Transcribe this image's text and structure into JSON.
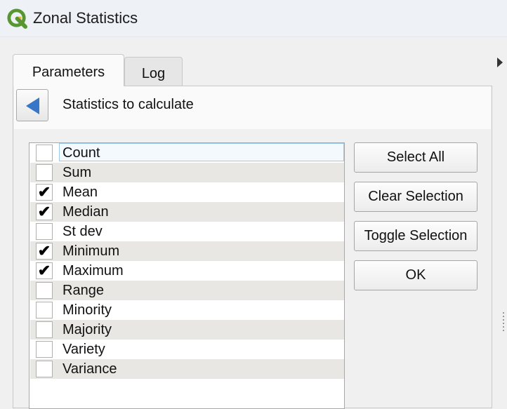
{
  "window": {
    "title": "Zonal Statistics",
    "icon": "qgis-logo-icon"
  },
  "tabs": [
    {
      "label": "Parameters",
      "active": true
    },
    {
      "label": "Log",
      "active": false
    }
  ],
  "panel": {
    "title": "Statistics to calculate",
    "back_icon": "back-arrow-icon"
  },
  "statistics": [
    {
      "label": "Count",
      "checked": false
    },
    {
      "label": "Sum",
      "checked": false
    },
    {
      "label": "Mean",
      "checked": true
    },
    {
      "label": "Median",
      "checked": true
    },
    {
      "label": "St dev",
      "checked": false
    },
    {
      "label": "Minimum",
      "checked": true
    },
    {
      "label": "Maximum",
      "checked": true
    },
    {
      "label": "Range",
      "checked": false
    },
    {
      "label": "Minority",
      "checked": false
    },
    {
      "label": "Majority",
      "checked": false
    },
    {
      "label": "Variety",
      "checked": false
    },
    {
      "label": "Variance",
      "checked": false
    }
  ],
  "buttons": {
    "select_all": "Select All",
    "clear_selection": "Clear Selection",
    "toggle_selection": "Toggle Selection",
    "ok": "OK"
  },
  "colors": {
    "accent": "#3876c8",
    "qgis_green": "#589632",
    "qgis_yellow": "#ee7913"
  }
}
